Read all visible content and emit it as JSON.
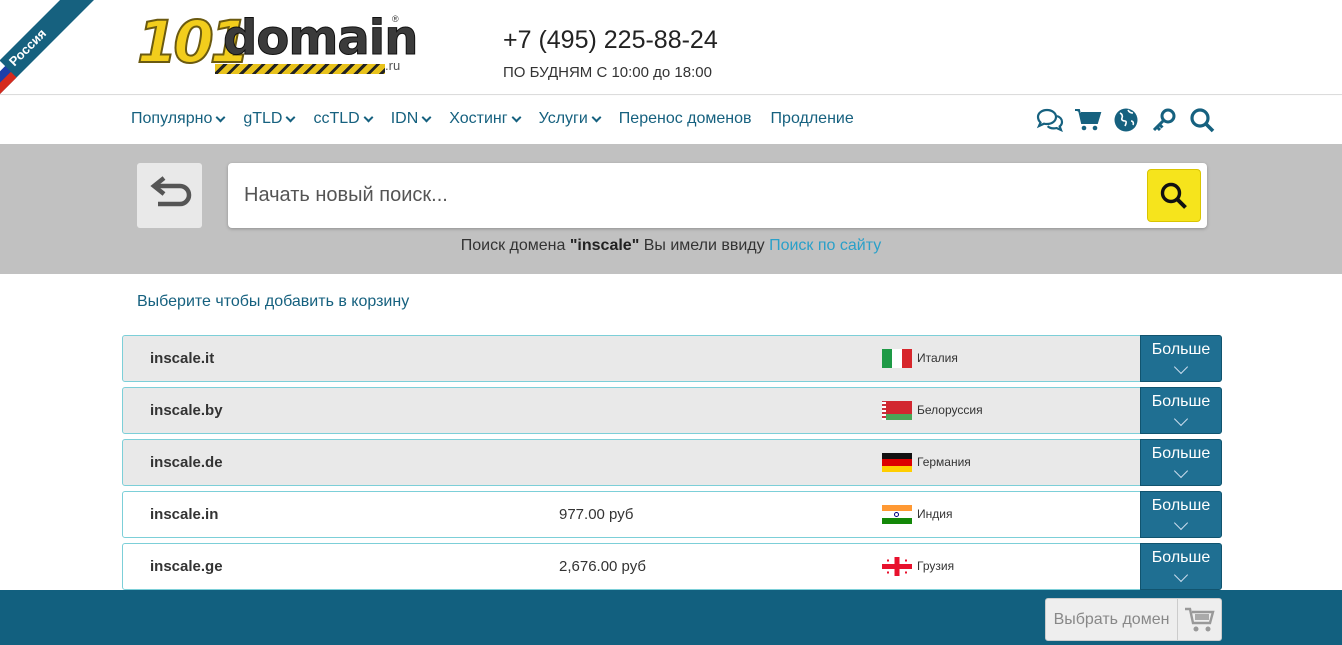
{
  "ribbon": {
    "label": "Россия"
  },
  "header": {
    "logo_number": "101",
    "logo_word": "domain",
    "logo_suffix": ".ru",
    "phone": "+7 (495) 225-88-24",
    "hours": "ПО БУДНЯМ С 10:00 до 18:00"
  },
  "nav": {
    "items": [
      {
        "label": "Популярно",
        "dropdown": true
      },
      {
        "label": "gTLD",
        "dropdown": true
      },
      {
        "label": "ccTLD",
        "dropdown": true
      },
      {
        "label": "IDN",
        "dropdown": true
      },
      {
        "label": "Хостинг",
        "dropdown": true
      },
      {
        "label": "Услуги",
        "dropdown": true
      },
      {
        "label": "Перенос доменов",
        "dropdown": false
      },
      {
        "label": "Продление",
        "dropdown": false
      }
    ],
    "icons": [
      "chat-icon",
      "cart-icon",
      "globe-icon",
      "key-icon",
      "search-icon"
    ],
    "accent_color": "#16617f"
  },
  "search": {
    "placeholder": "Начать новый поиск...",
    "hint_prefix": "Поиск домена ",
    "hint_query": "\"inscale\"",
    "hint_middle": " Вы имели ввиду ",
    "hint_link": "Поиск по сайту"
  },
  "results": {
    "choose_label": "Выберите чтобы добавить в корзину",
    "more_label": "Больше",
    "rows": [
      {
        "domain": "inscale.it",
        "price": "",
        "country": "Италия",
        "available": false
      },
      {
        "domain": "inscale.by",
        "price": "",
        "country": "Белоруссия",
        "available": false
      },
      {
        "domain": "inscale.de",
        "price": "",
        "country": "Германия",
        "available": false
      },
      {
        "domain": "inscale.in",
        "price": "977.00 руб",
        "country": "Индия",
        "available": true
      },
      {
        "domain": "inscale.ge",
        "price": "2,676.00 руб",
        "country": "Грузия",
        "available": true
      }
    ]
  },
  "footer": {
    "pick_label": "Выбрать домен"
  }
}
